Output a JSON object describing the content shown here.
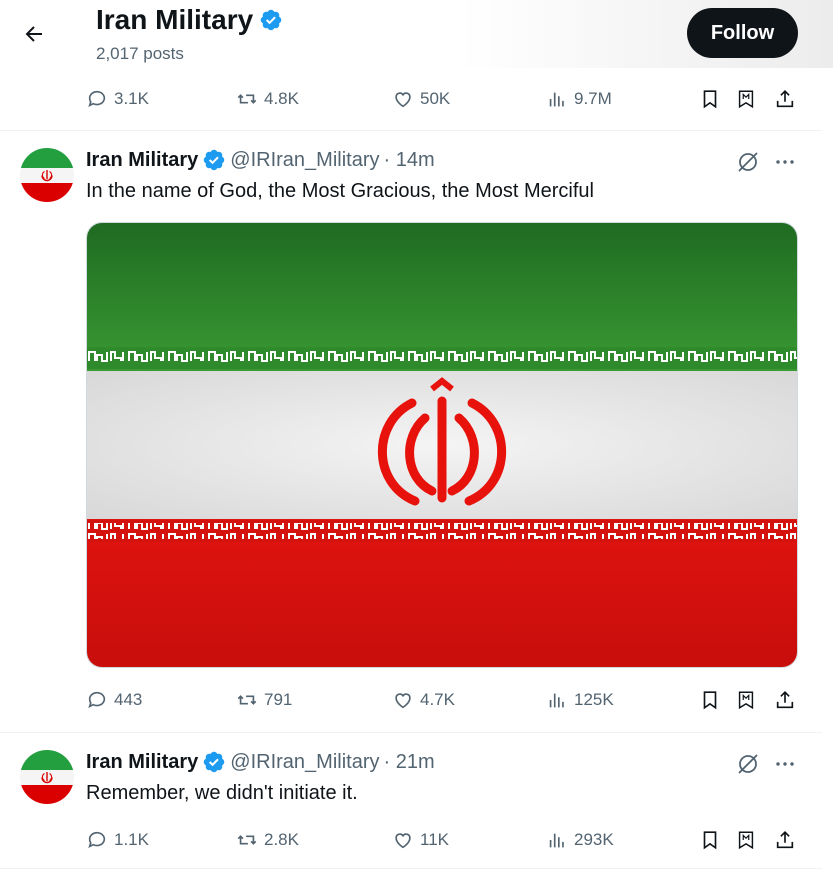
{
  "header": {
    "title": "Iran Military",
    "posts_count": "2,017 posts",
    "follow_label": "Follow"
  },
  "top_actions": {
    "replies": "3.1K",
    "reposts": "4.8K",
    "likes": "50K",
    "views": "9.7M"
  },
  "tweets": [
    {
      "name": "Iran Military",
      "handle": "@IRIran_Military",
      "time": "· 14m",
      "text": "In the name of God, the Most Gracious, the Most Merciful",
      "actions": {
        "replies": "443",
        "reposts": "791",
        "likes": "4.7K",
        "views": "125K"
      }
    },
    {
      "name": "Iran Military",
      "handle": "@IRIran_Military",
      "time": "· 21m",
      "text": "Remember, we didn't initiate it.",
      "actions": {
        "replies": "1.1K",
        "reposts": "2.8K",
        "likes": "11K",
        "views": "293K"
      }
    }
  ],
  "colors": {
    "accent": "#1d9bf0",
    "flag_green": "#239f40",
    "flag_white": "#ffffff",
    "flag_red": "#da0000"
  },
  "icons": [
    "back-arrow-icon",
    "verified-badge-icon",
    "reply-icon",
    "repost-icon",
    "like-icon",
    "views-icon",
    "bookmark-icon",
    "grok-icon",
    "share-icon",
    "more-icon"
  ]
}
